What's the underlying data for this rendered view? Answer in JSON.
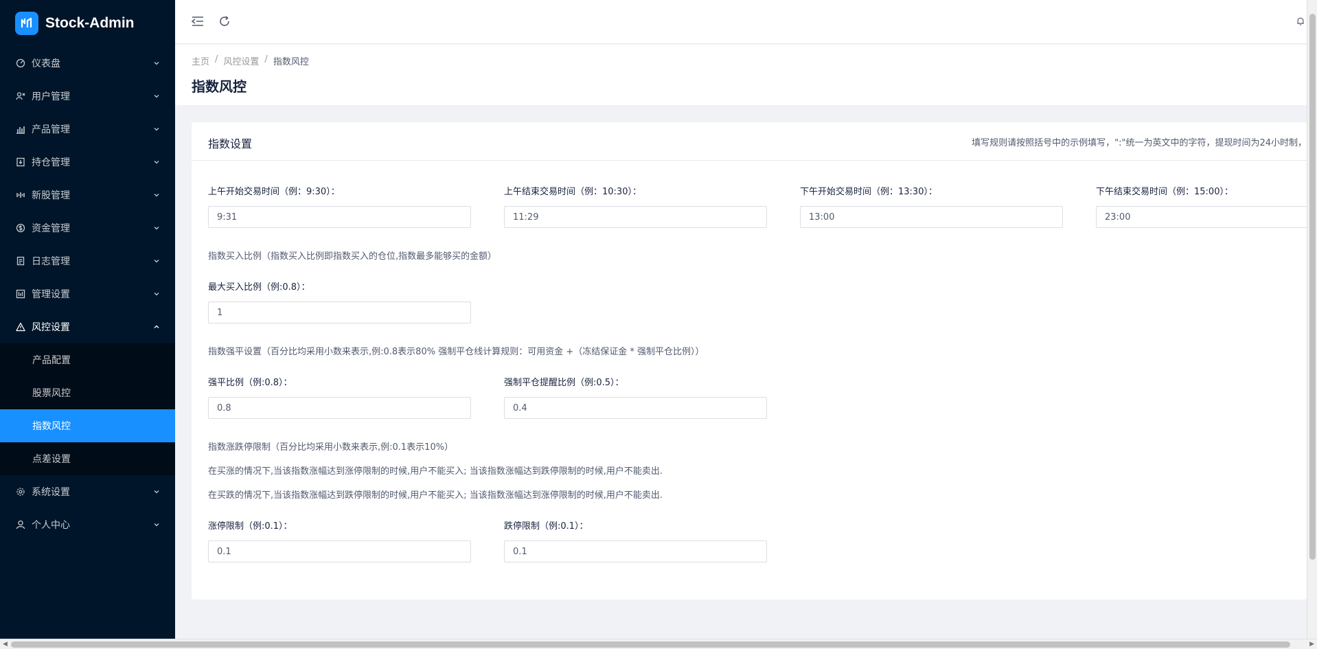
{
  "app": {
    "title": "Stock-Admin"
  },
  "colors": {
    "sidebar_bg": "#001529",
    "active": "#1890ff"
  },
  "sidebar": {
    "items": [
      {
        "label": "仪表盘",
        "icon": "dashboard-icon"
      },
      {
        "label": "用户管理",
        "icon": "users-icon"
      },
      {
        "label": "产品管理",
        "icon": "bar-chart-icon"
      },
      {
        "label": "持仓管理",
        "icon": "download-box-icon"
      },
      {
        "label": "新股管理",
        "icon": "signal-icon"
      },
      {
        "label": "资金管理",
        "icon": "money-icon"
      },
      {
        "label": "日志管理",
        "icon": "log-icon"
      },
      {
        "label": "管理设置",
        "icon": "panel-icon"
      },
      {
        "label": "风控设置",
        "icon": "warning-icon"
      },
      {
        "label": "系统设置",
        "icon": "gear-icon"
      },
      {
        "label": "个人中心",
        "icon": "user-icon"
      }
    ],
    "submenu": [
      "产品配置",
      "股票风控",
      "指数风控",
      "点差设置"
    ]
  },
  "breadcrumb": {
    "home": "主页",
    "parent": "风控设置",
    "current": "指数风控",
    "sep": "/"
  },
  "page": {
    "title": "指数风控"
  },
  "card": {
    "title": "指数设置",
    "extra": "填写规则请按照括号中的示例填写，\":\"统一为英文中的字符，提现时间为24小时制，"
  },
  "form": {
    "am_start": {
      "label": "上午开始交易时间（例：9:30）：",
      "value": "9:31"
    },
    "am_end": {
      "label": "上午结束交易时间（例：10:30）：",
      "value": "11:29"
    },
    "pm_start": {
      "label": "下午开始交易时间（例：13:30）：",
      "value": "13:00"
    },
    "pm_end": {
      "label": "下午结束交易时间（例：15:00）：",
      "value": "23:00"
    },
    "buy_note": "指数买入比例（指数买入比例即指数买入的仓位,指数最多能够买的金额）",
    "max_buy": {
      "label": "最大买入比例（例:0.8）：",
      "value": "1"
    },
    "force_note": "指数强平设置（百分比均采用小数来表示,例:0.8表示80% 强制平仓线计算规则：可用资金 +（冻结保证金 * 强制平仓比例））",
    "force_ratio": {
      "label": "强平比例（例:0.8）：",
      "value": "0.8"
    },
    "force_warn": {
      "label": "强制平仓提醒比例（例:0.5）：",
      "value": "0.4"
    },
    "limit_note": "指数涨跌停限制（百分比均采用小数来表示,例:0.1表示10%）",
    "limit_note2": "在买涨的情况下,当该指数涨幅达到涨停限制的时候,用户不能买入; 当该指数涨幅达到跌停限制的时候,用户不能卖出.",
    "limit_note3": "在买跌的情况下,当该指数涨幅达到跌停限制的时候,用户不能买入; 当该指数涨幅达到涨停限制的时候,用户不能卖出.",
    "up_limit": {
      "label": "涨停限制（例:0.1）：",
      "value": "0.1"
    },
    "down_limit": {
      "label": "跌停限制（例:0.1）：",
      "value": "0.1"
    }
  }
}
